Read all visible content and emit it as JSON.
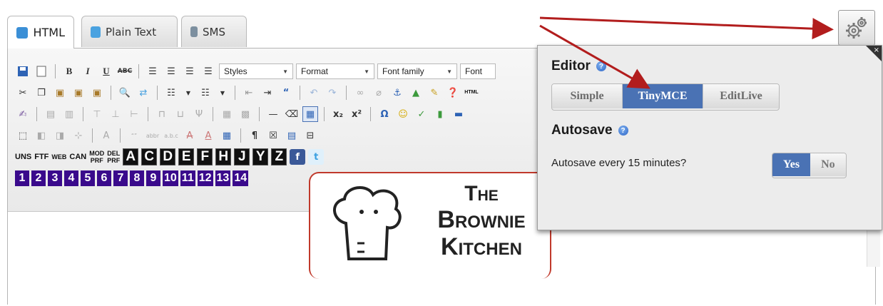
{
  "tabs": [
    {
      "label": "HTML",
      "icon": "html-doc-icon",
      "active": true
    },
    {
      "label": "Plain Text",
      "icon": "plain-doc-icon",
      "active": false
    },
    {
      "label": "SMS",
      "icon": "phone-icon",
      "active": false
    }
  ],
  "toolbar": {
    "dropdowns": {
      "styles": "Styles",
      "format": "Format",
      "font_family": "Font family",
      "font_size": "Font"
    },
    "code_buttons": [
      "UNS",
      "FTF",
      "WEB",
      "CAN"
    ],
    "code_buttons_stacked": [
      [
        "MOD",
        "PRF"
      ],
      [
        "DEL",
        "PRF"
      ]
    ],
    "letter_buttons": [
      "A",
      "C",
      "D",
      "E",
      "F",
      "H",
      "J",
      "Y",
      "Z"
    ],
    "number_buttons": [
      "1",
      "2",
      "3",
      "4",
      "5",
      "6",
      "7",
      "8",
      "9",
      "10",
      "11",
      "12",
      "13",
      "14"
    ],
    "html_label": "HTML"
  },
  "content": {
    "logo": {
      "line1": "The",
      "line2": "Brownie",
      "line3": "Kitchen"
    }
  },
  "settings_panel": {
    "editor_title": "Editor",
    "editor_options": [
      "Simple",
      "TinyMCE",
      "EditLive"
    ],
    "editor_selected": "TinyMCE",
    "autosave_title": "Autosave",
    "autosave_question": "Autosave every 15 minutes?",
    "autosave_options": [
      "Yes",
      "No"
    ],
    "autosave_selected": "Yes",
    "close_glyph": "×"
  },
  "colors": {
    "accent": "#4a72b4",
    "arrow": "#b21d1d",
    "number_bg": "#3a0a8c"
  }
}
